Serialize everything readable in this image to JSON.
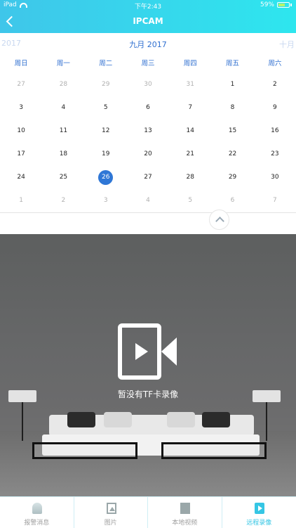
{
  "status": {
    "device": "iPad",
    "time": "下午2:43",
    "battery": "59%"
  },
  "header": {
    "title": "IPCAM"
  },
  "calendar": {
    "prev_year": "2017",
    "month": "九月 2017",
    "next_month": "十月",
    "weekdays": [
      "周日",
      "周一",
      "周二",
      "周三",
      "周四",
      "周五",
      "周六"
    ],
    "weeks": [
      [
        "27",
        "28",
        "29",
        "30",
        "31",
        "1",
        "2"
      ],
      [
        "3",
        "4",
        "5",
        "6",
        "7",
        "8",
        "9"
      ],
      [
        "10",
        "11",
        "12",
        "13",
        "14",
        "15",
        "16"
      ],
      [
        "17",
        "18",
        "19",
        "20",
        "21",
        "22",
        "23"
      ],
      [
        "24",
        "25",
        "26",
        "27",
        "28",
        "29",
        "30"
      ],
      [
        "1",
        "2",
        "3",
        "4",
        "5",
        "6",
        "7"
      ]
    ],
    "selected": "26"
  },
  "empty_state": {
    "text": "暂没有TF卡录像"
  },
  "tabs": [
    {
      "label": "报警消息",
      "icon": "bell-icon"
    },
    {
      "label": "图片",
      "icon": "picture-icon"
    },
    {
      "label": "本地视频",
      "icon": "film-icon"
    },
    {
      "label": "远程录像",
      "icon": "remote-video-icon"
    }
  ],
  "colors": {
    "accent": "#35c6e4",
    "selected_day": "#2f77d6",
    "calendar_text": "#2f6fd0"
  }
}
